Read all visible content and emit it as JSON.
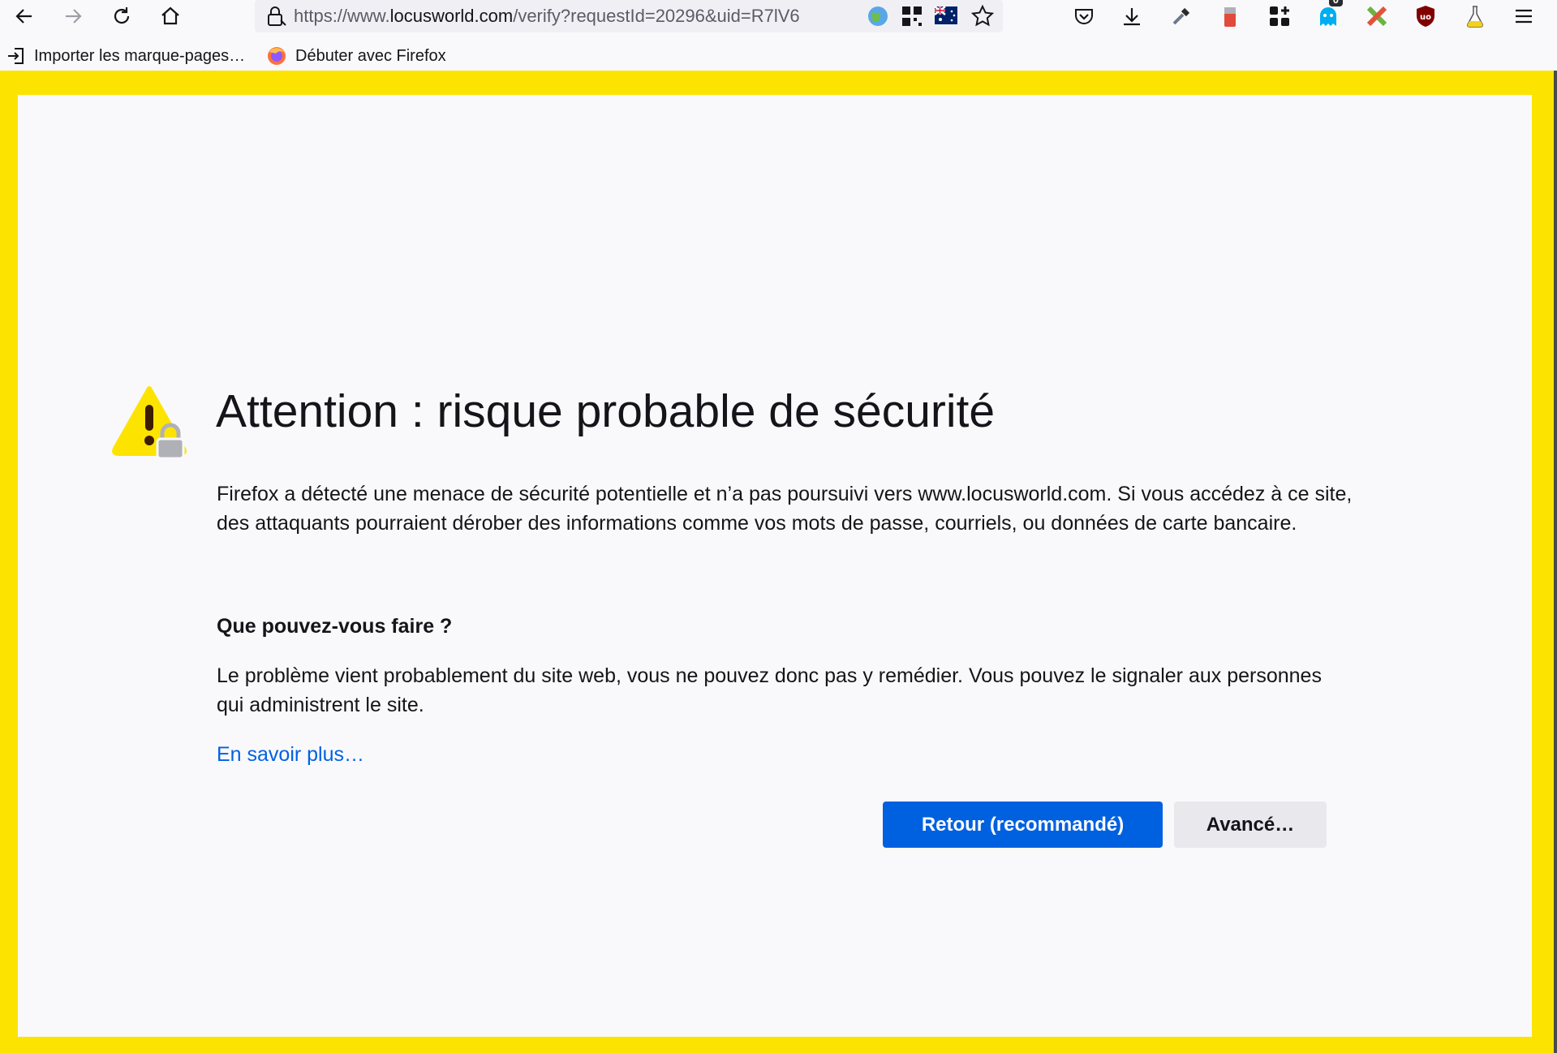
{
  "browser": {
    "url": {
      "prefix": "https://www.",
      "host": "locusworld.com",
      "rest": "/verify?requestId=20296&uid=R7lV6"
    },
    "bookmarks": [
      {
        "label": "Importer les marque-pages…",
        "icon": "import-icon"
      },
      {
        "label": "Débuter avec Firefox",
        "icon": "firefox-icon"
      }
    ],
    "extension_badge_count": "0"
  },
  "error_page": {
    "title": "Attention : risque probable de sécurité",
    "intro": "Firefox a détecté une menace de sécurité potentielle et n’a pas poursuivi vers www.locusworld.com. Si vous accédez à ce site, des attaquants pourraient dérober des informations comme vos mots de passe, courriels, ou données de carte bancaire.",
    "what_heading": "Que pouvez-vous faire ?",
    "explanation": "Le problème vient probablement du site web, vous ne pouvez donc pas y remédier. Vous pouvez le signaler aux personnes qui administrent le site.",
    "learn_more": "En savoir plus…",
    "back_button": "Retour (recommandé)",
    "advanced_button": "Avancé…"
  },
  "colors": {
    "frame_border": "#fde400",
    "primary_button": "#0061e0",
    "link": "#0061e0"
  }
}
